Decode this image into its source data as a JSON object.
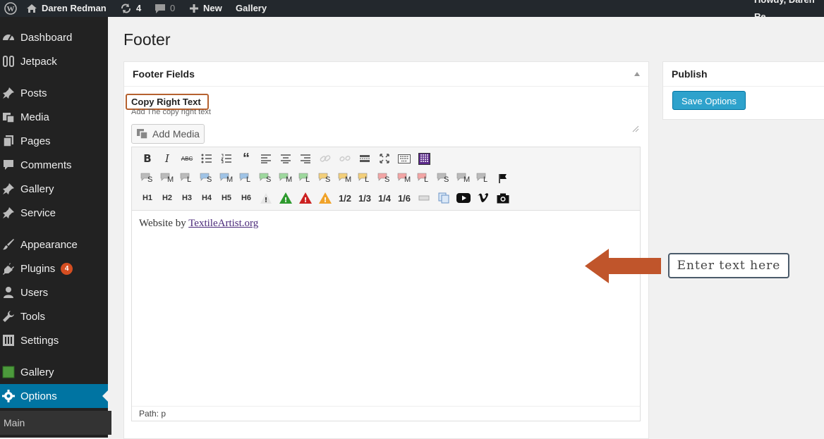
{
  "adminbar": {
    "site_name": "Daren Redman",
    "updates_count": "4",
    "comments_count": "0",
    "new_label": "New",
    "gallery_label": "Gallery",
    "greeting": "Howdy, Daren Re"
  },
  "sidebar": {
    "items": [
      {
        "label": "Dashboard",
        "icon": "dashboard-icon"
      },
      {
        "label": "Jetpack",
        "icon": "jetpack-icon"
      },
      {
        "label": "Posts",
        "icon": "pin-icon"
      },
      {
        "label": "Media",
        "icon": "media-icon"
      },
      {
        "label": "Pages",
        "icon": "pages-icon"
      },
      {
        "label": "Comments",
        "icon": "comment-icon"
      },
      {
        "label": "Gallery",
        "icon": "pin-icon"
      },
      {
        "label": "Service",
        "icon": "pin-icon"
      },
      {
        "label": "Appearance",
        "icon": "brush-icon"
      },
      {
        "label": "Plugins",
        "icon": "plugin-icon",
        "badge": "4"
      },
      {
        "label": "Users",
        "icon": "users-icon"
      },
      {
        "label": "Tools",
        "icon": "wrench-icon"
      },
      {
        "label": "Settings",
        "icon": "settings-icon"
      },
      {
        "label": "Gallery",
        "icon": "gallery-square-icon"
      },
      {
        "label": "Options",
        "icon": "gear-icon"
      }
    ],
    "submenu_item": "Main"
  },
  "page": {
    "title": "Footer"
  },
  "footer_fields": {
    "title": "Footer Fields",
    "field_label": "Copy Right Text",
    "field_description": "Add The copy right text",
    "add_media_label": "Add Media",
    "content_prefix": "Website by ",
    "content_link": "TextileArtist.org",
    "path_text": "Path: p"
  },
  "toolbar": {
    "row3_labels": [
      "H1",
      "H2",
      "H3",
      "H4",
      "H5",
      "H6",
      "!",
      "!",
      "!",
      "!",
      "1/2",
      "1/3",
      "1/4",
      "1/6"
    ],
    "row2_labels": [
      "S",
      "M",
      "L",
      "S",
      "M",
      "L",
      "S",
      "M",
      "L",
      "S",
      "M",
      "L",
      "S",
      "M",
      "L",
      "S",
      "M",
      "L"
    ],
    "row2_colors": [
      "#bbbbbb",
      "#bbbbbb",
      "#bbbbbb",
      "#9fc3e6",
      "#9fc3e6",
      "#9fc3e6",
      "#9ed89e",
      "#9ed89e",
      "#9ed89e",
      "#f3cf7a",
      "#f3cf7a",
      "#f3cf7a",
      "#f2a5a5",
      "#f2a5a5",
      "#f2a5a5",
      "#bbbbbb",
      "#bbbbbb",
      "#bbbbbb"
    ]
  },
  "publish": {
    "title": "Publish",
    "save_label": "Save Options"
  },
  "callout": {
    "text": "Enter text here",
    "arrow_color": "#c0552b"
  },
  "colors": {
    "accent": "#0074a2",
    "button": "#2ea2cc",
    "badge": "#d54e21",
    "highlight_border": "#b5612f"
  }
}
